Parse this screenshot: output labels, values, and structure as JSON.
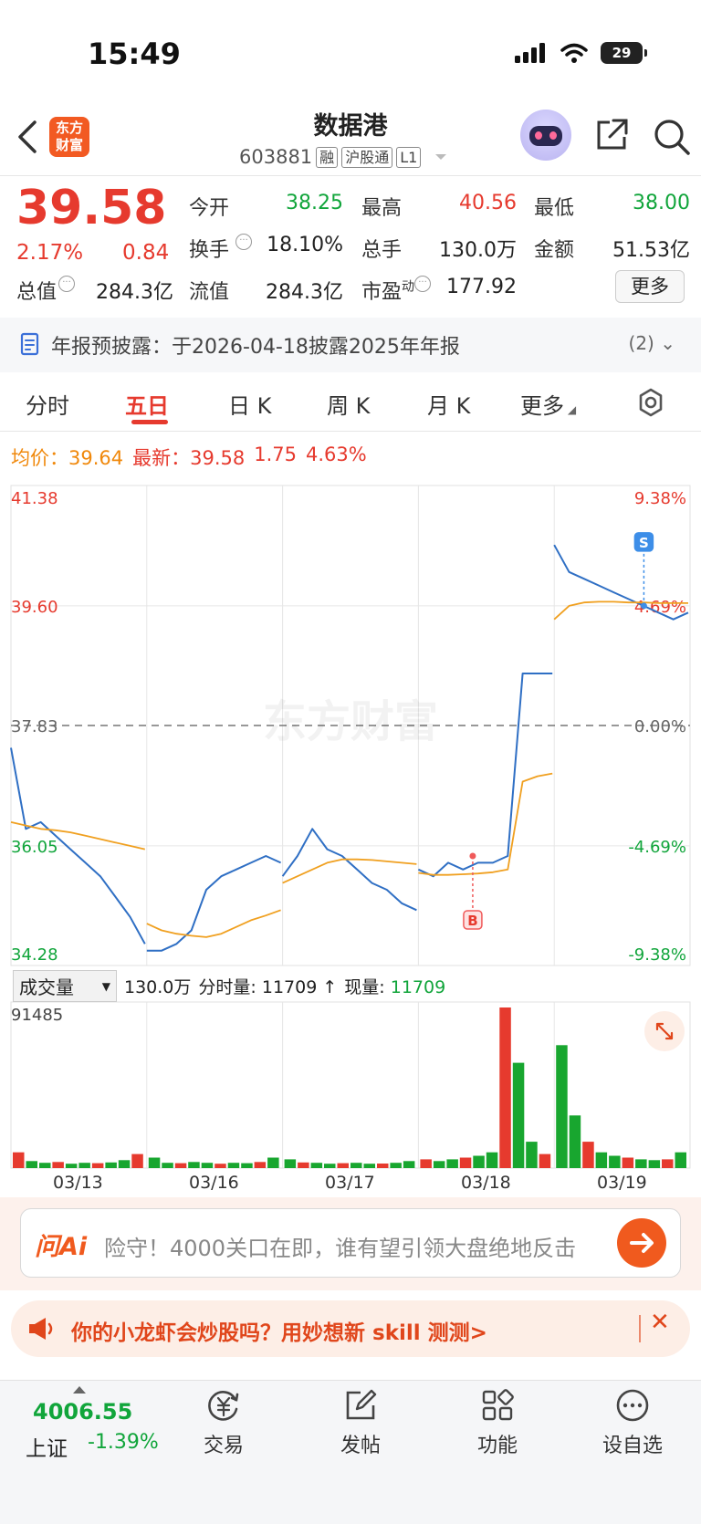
{
  "status": {
    "time": "15:49",
    "battery": "29"
  },
  "header": {
    "logo": [
      "东方",
      "财富"
    ],
    "title": "数据港",
    "code": "603881",
    "tags": [
      "融",
      "沪股通",
      "L1"
    ]
  },
  "quote": {
    "price": "39.58",
    "change_pct": "2.17%",
    "change": "0.84",
    "open_label": "今开",
    "open": "38.25",
    "high_label": "最高",
    "high": "40.56",
    "low_label": "最低",
    "low": "38.00",
    "turnover_label": "换手",
    "turnover": "18.10%",
    "volume_label": "总手",
    "volume": "130.0万",
    "amount_label": "金额",
    "amount": "51.53亿",
    "mktcap_label": "总值",
    "mktcap": "284.3亿",
    "float_label": "流值",
    "float": "284.3亿",
    "pe_label": "市盈",
    "pe_sup": "动",
    "pe": "177.92",
    "more": "更多"
  },
  "notice": {
    "label": "年报预披露：",
    "text": "于2026-04-18披露2025年年报",
    "count": "(2)"
  },
  "tabs": [
    "分时",
    "五日",
    "日 K",
    "周 K",
    "月 K",
    "更多"
  ],
  "legend": {
    "avg_label": "均价：",
    "avg": "39.64",
    "last_label": "最新：",
    "last": "39.58",
    "chg": "1.75",
    "chg_pct": "4.63%"
  },
  "chart_data": {
    "type": "line",
    "title": "",
    "watermark": "东方财富",
    "x_labels": [
      "03/13",
      "03/16",
      "03/17",
      "03/18",
      "03/19"
    ],
    "y_labels_left": [
      "41.38",
      "39.60",
      "37.83",
      "36.05",
      "34.28"
    ],
    "y_labels_right": [
      "9.38%",
      "4.69%",
      "0.00%",
      "-4.69%",
      "-9.38%"
    ],
    "ylim": [
      34.28,
      41.38
    ],
    "prev_close": 37.83,
    "series": [
      {
        "name": "最新",
        "color": "#2f6fc4",
        "days": [
          [
            37.5,
            36.3,
            36.4,
            36.2,
            36.0,
            35.8,
            35.6,
            35.3,
            35.0,
            34.6
          ],
          [
            34.5,
            34.5,
            34.6,
            34.8,
            35.4,
            35.6,
            35.7,
            35.8,
            35.9,
            35.8
          ],
          [
            35.6,
            35.9,
            36.3,
            36.0,
            35.9,
            35.7,
            35.5,
            35.4,
            35.2,
            35.1
          ],
          [
            35.7,
            35.6,
            35.8,
            35.7,
            35.8,
            35.8,
            35.9,
            38.6,
            38.6,
            38.6
          ],
          [
            40.5,
            40.1,
            40.0,
            39.9,
            39.8,
            39.7,
            39.6,
            39.5,
            39.4,
            39.5
          ]
        ]
      },
      {
        "name": "均价",
        "color": "#f0a020",
        "days": [
          [
            36.4,
            36.35,
            36.3,
            36.28,
            36.25,
            36.2,
            36.15,
            36.1,
            36.05,
            36.0
          ],
          [
            34.9,
            34.8,
            34.75,
            34.72,
            34.7,
            34.75,
            34.85,
            34.95,
            35.02,
            35.1
          ],
          [
            35.5,
            35.6,
            35.7,
            35.8,
            35.85,
            35.85,
            35.84,
            35.82,
            35.8,
            35.78
          ],
          [
            35.65,
            35.62,
            35.62,
            35.63,
            35.64,
            35.66,
            35.7,
            37.0,
            37.08,
            37.12
          ],
          [
            39.4,
            39.6,
            39.65,
            39.66,
            39.66,
            39.65,
            39.65,
            39.64,
            39.64,
            39.64
          ]
        ]
      }
    ],
    "markers": [
      {
        "label": "B",
        "day": 3,
        "pos": 0.4,
        "price": 35.9,
        "color": "#f05a5a"
      },
      {
        "label": "S",
        "day": 4,
        "pos": 0.66,
        "price": 39.6,
        "color": "#3d8ee8"
      }
    ],
    "volume": {
      "label": "成交量",
      "total": "130.0万",
      "split_label": "分时量:",
      "split": "11709",
      "now_label": "现量:",
      "now": "11709",
      "ymax_label": "91485",
      "ymax": 91485,
      "days": [
        [
          9000,
          4000,
          3000,
          3500,
          2500,
          3000,
          2800,
          3200,
          4500,
          8000
        ],
        [
          6000,
          3000,
          2800,
          3500,
          3000,
          2500,
          3000,
          2800,
          3500,
          6000
        ],
        [
          5000,
          3200,
          3000,
          2500,
          2800,
          3000,
          2500,
          2600,
          3000,
          4000
        ],
        [
          5000,
          4000,
          5000,
          6000,
          7000,
          9000,
          91485,
          60000,
          15000,
          8000
        ],
        [
          70000,
          30000,
          15000,
          9000,
          7000,
          6000,
          5000,
          4500,
          5000,
          9000
        ]
      ]
    }
  },
  "ai": {
    "logo": "问Ai",
    "prompt": "险守！4000关口在即，谁有望引领大盘绝地反击"
  },
  "promo": {
    "text": "你的小龙虾会炒股吗？用妙想新 skill 测测>"
  },
  "bottom_nav": {
    "index_value": "4006.55",
    "index_name": "上证",
    "index_pct": "-1.39%",
    "items": [
      "交易",
      "发帖",
      "功能",
      "设自选"
    ]
  }
}
